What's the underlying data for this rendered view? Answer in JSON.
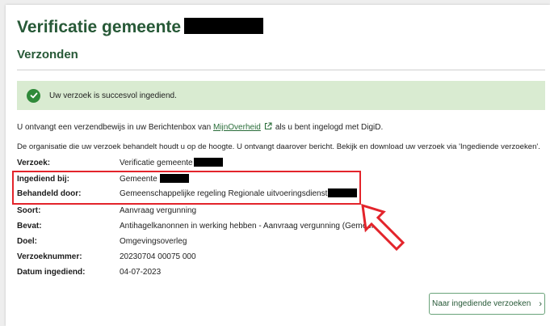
{
  "page": {
    "title": "Verificatie gemeente",
    "subtitle": "Verzonden"
  },
  "alert": {
    "message": "Uw verzoek is succesvol ingediend."
  },
  "info": {
    "line1_before": "U ontvangt een verzendbewijs in uw Berichtenbox van",
    "line1_link": "MijnOverheid",
    "line1_after": "als u bent ingelogd met DigiD.",
    "line2": "De organisatie die uw verzoek behandelt houdt u op de hoogte. U ontvangt daarover bericht. Bekijk en download uw verzoek via 'Ingediende verzoeken'."
  },
  "details": [
    {
      "label": "Verzoek:",
      "value": "Verificatie gemeente"
    },
    {
      "label": "Ingediend bij:",
      "value": "Gemeente"
    },
    {
      "label": "Behandeld door:",
      "value": "Gemeenschappelijke regeling Regionale uitvoeringsdienst"
    },
    {
      "label": "Soort:",
      "value": "Aanvraag vergunning"
    },
    {
      "label": "Bevat:",
      "value": "Antihagelkanonnen in werking hebben - Aanvraag vergunning (Gemeente)"
    },
    {
      "label": "Doel:",
      "value": "Omgevingsoverleg"
    },
    {
      "label": "Verzoeknummer:",
      "value": "20230704 00075 000"
    },
    {
      "label": "Datum ingediend:",
      "value": "04-07-2023"
    }
  ],
  "button": {
    "label": "Naar ingediende verzoeken"
  },
  "colors": {
    "heading": "#275937",
    "alert_bg": "#d9ebd1",
    "highlight": "#e3242b"
  }
}
